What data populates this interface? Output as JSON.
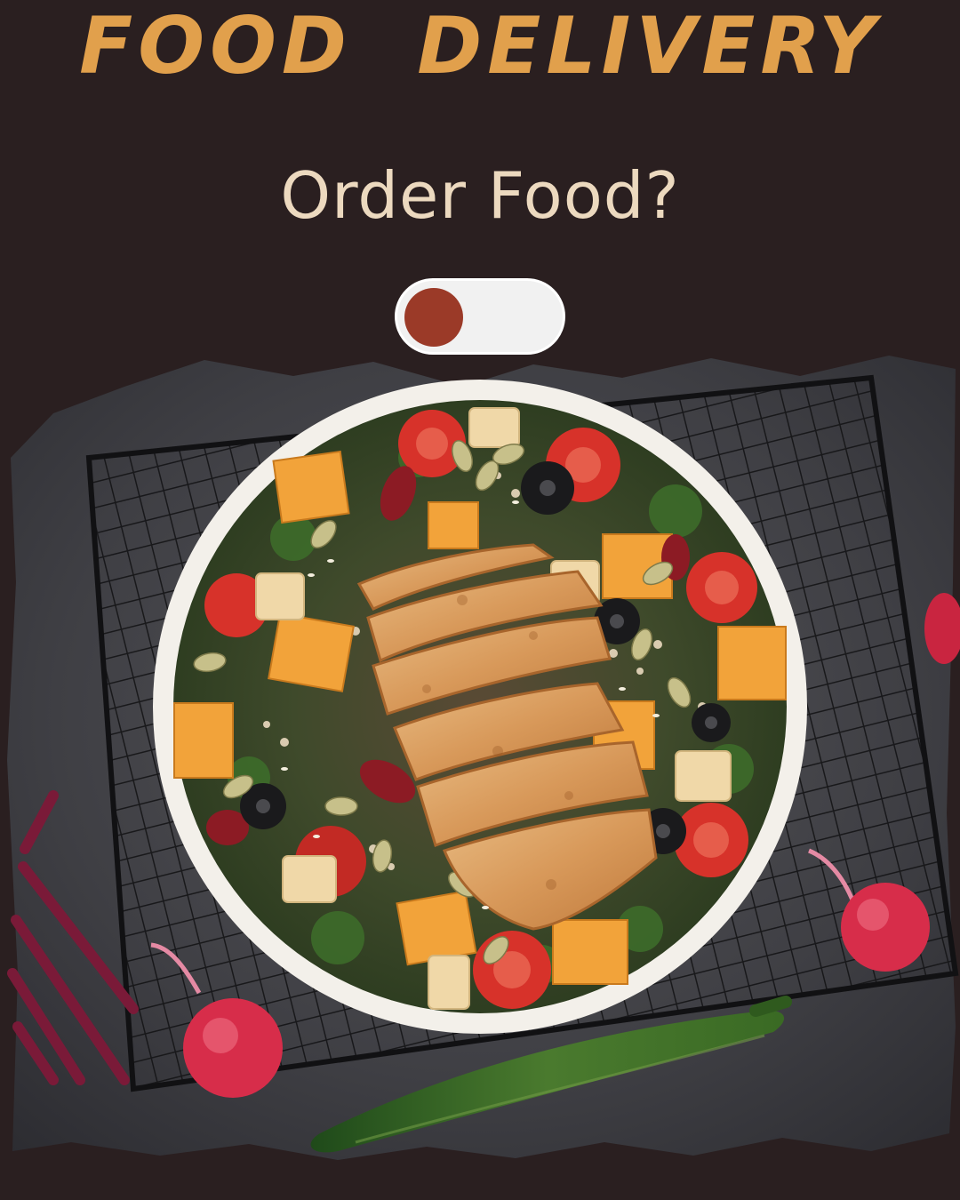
{
  "header": {
    "title": "FOOD  DELIVERY",
    "question": "Order Food?"
  },
  "toggle": {
    "state": "off"
  },
  "colors": {
    "background": "#2a1f20",
    "title": "#e1a04c",
    "question": "#ecd9bf",
    "toggle_track": "#f1f1f1",
    "toggle_knob": "#9b3a28"
  },
  "icons": {
    "toggle_knob": "circle"
  }
}
